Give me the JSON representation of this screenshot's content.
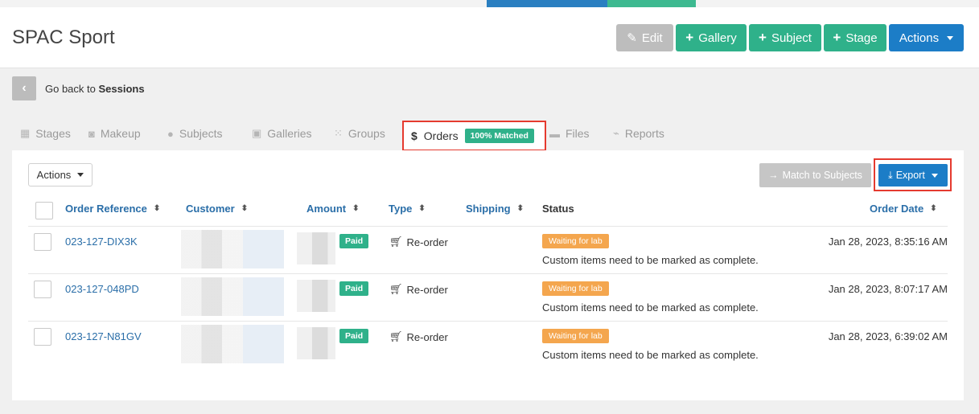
{
  "page": {
    "title": "SPAC Sport"
  },
  "header_buttons": {
    "edit": "Edit",
    "gallery": "Gallery",
    "subject": "Subject",
    "stage": "Stage",
    "actions": "Actions"
  },
  "back": {
    "prefix": "Go back to ",
    "target": "Sessions"
  },
  "tabs": [
    {
      "label": "Stages",
      "icon": "table-icon"
    },
    {
      "label": "Makeup",
      "icon": "camera-icon"
    },
    {
      "label": "Subjects",
      "icon": "user-icon"
    },
    {
      "label": "Galleries",
      "icon": "image-icon"
    },
    {
      "label": "Groups",
      "icon": "grid-icon"
    },
    {
      "label": "Orders",
      "icon": "dollar-icon",
      "active": true,
      "badge": "100% Matched"
    },
    {
      "label": "Files",
      "icon": "folder-icon"
    },
    {
      "label": "Reports",
      "icon": "chart-icon"
    }
  ],
  "toolbar": {
    "actions": "Actions",
    "match": "Match to Subjects",
    "export": "Export"
  },
  "table": {
    "columns": [
      "Order Reference",
      "Customer",
      "Amount",
      "Type",
      "Shipping",
      "Status",
      "Order Date"
    ],
    "rows": [
      {
        "ref": "023-127-DIX3K",
        "paid": "Paid",
        "type": "Re-order",
        "status": "Waiting for lab",
        "note": "Custom items need to be marked as complete.",
        "date": "Jan 28, 2023, 8:35:16 AM"
      },
      {
        "ref": "023-127-048PD",
        "paid": "Paid",
        "type": "Re-order",
        "status": "Waiting for lab",
        "note": "Custom items need to be marked as complete.",
        "date": "Jan 28, 2023, 8:07:17 AM"
      },
      {
        "ref": "023-127-N81GV",
        "paid": "Paid",
        "type": "Re-order",
        "status": "Waiting for lab",
        "note": "Custom items need to be marked as complete.",
        "date": "Jan 28, 2023, 6:39:02 AM"
      }
    ]
  },
  "colors": {
    "green": "#2fb18a",
    "blue": "#1c7dc7",
    "orange": "#f4a64e",
    "highlight": "#e53a2f"
  }
}
